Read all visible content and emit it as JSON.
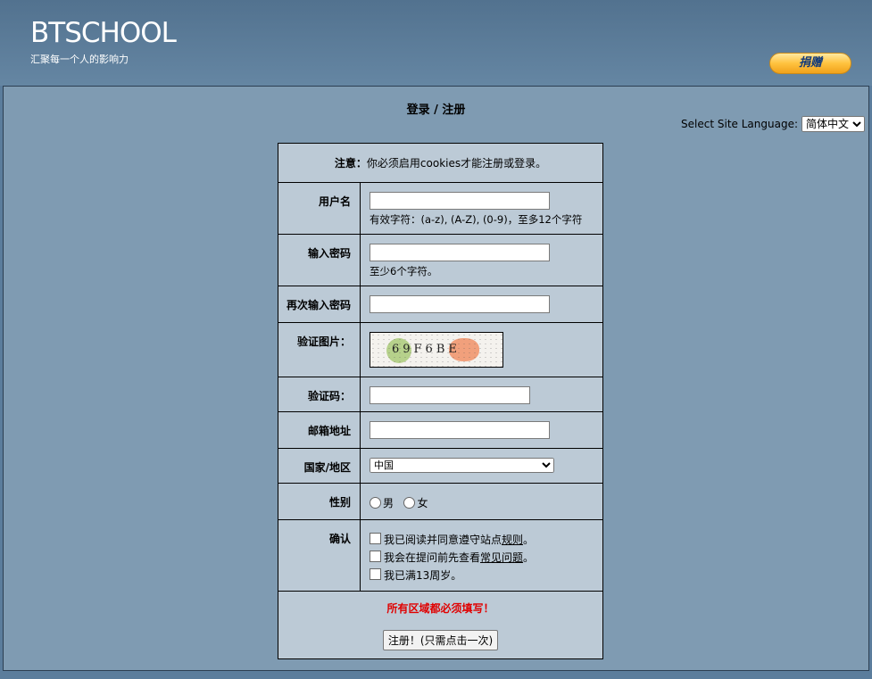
{
  "header": {
    "logo": "BTSCHOOL",
    "slogan": "汇聚每一个人的影响力",
    "donate_label": "捐赠"
  },
  "page": {
    "title": "登录 / 注册",
    "language_label": "Select Site Language:",
    "language_value": "简体中文"
  },
  "form": {
    "note_label": "注意：",
    "note_text": "你必须启用cookies才能注册或登录。",
    "username_label": "用户名",
    "username_hint": "有效字符：(a-z), (A-Z), (0-9)，至多12个字符",
    "password_label": "输入密码",
    "password_hint": "至少6个字符。",
    "password2_label": "再次输入密码",
    "captcha_label": "验证图片：",
    "captcha_code": "69F6BE",
    "captcha_input_label": "验证码：",
    "email_label": "邮箱地址",
    "country_label": "国家/地区",
    "country_value": "中国",
    "gender_label": "性别",
    "gender_male": "男",
    "gender_female": "女",
    "confirm_label": "确认",
    "confirm_rules_prefix": "我已阅读并同意遵守站点",
    "confirm_rules_link": "规则",
    "confirm_rules_suffix": "。",
    "confirm_faq_prefix": "我会在提问前先查看",
    "confirm_faq_link": "常见问题",
    "confirm_faq_suffix": "。",
    "confirm_age": "我已满13周岁。",
    "required_text": "所有区域都必须填写！",
    "submit_label": "注册！(只需点击一次)"
  }
}
